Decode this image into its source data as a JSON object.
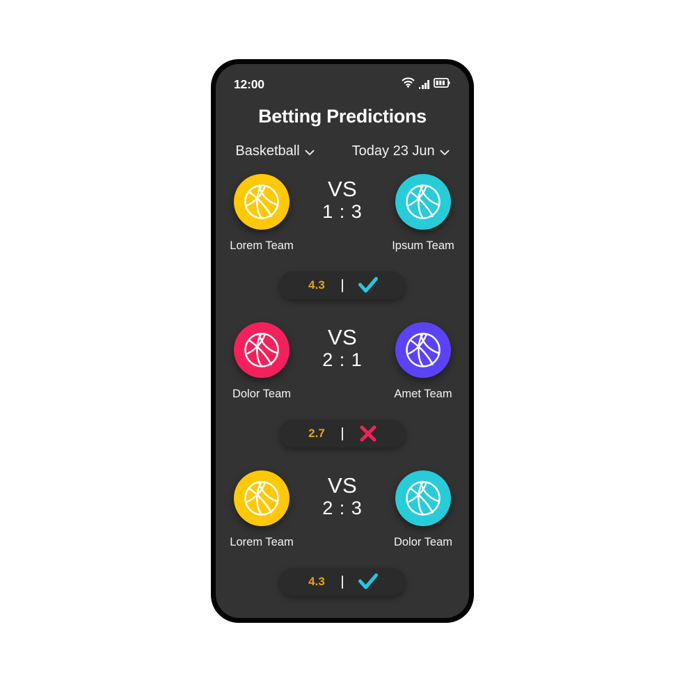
{
  "status_bar": {
    "time": "12:00",
    "icons": [
      "wifi-icon",
      "signal-icon",
      "battery-icon"
    ]
  },
  "header": {
    "title": "Betting Predictions"
  },
  "filters": [
    {
      "label": "Basketball",
      "icon": "chevron-down-icon"
    },
    {
      "label": "Today 23 Jun",
      "icon": "chevron-down-icon"
    }
  ],
  "colors": {
    "screen_bg": "#333333",
    "pill_bg": "#2b2b2b",
    "odds_text": "#e0a51c",
    "yellow": "#FFC808",
    "cyan": "#27CCD8",
    "pink": "#F4205C",
    "purple": "#5B43F5",
    "check": "#22C9E0",
    "cross": "#F4205C"
  },
  "matches": [
    {
      "home": {
        "name": "Lorem Team",
        "color": "#FFC808",
        "icon": "basketball-icon"
      },
      "away": {
        "name": "Ipsum Team",
        "color": "#27CCD8",
        "icon": "basketball-icon"
      },
      "vs_label": "VS",
      "score": "1 : 3",
      "odds": "4.3",
      "result": "win",
      "result_icon": "check-icon",
      "result_color": "#22C9E0"
    },
    {
      "home": {
        "name": "Dolor Team",
        "color": "#F4205C",
        "icon": "basketball-icon"
      },
      "away": {
        "name": "Amet Team",
        "color": "#5B43F5",
        "icon": "basketball-icon"
      },
      "vs_label": "VS",
      "score": "2 : 1",
      "odds": "2.7",
      "result": "lose",
      "result_icon": "cross-icon",
      "result_color": "#F4205C"
    },
    {
      "home": {
        "name": "Lorem Team",
        "color": "#FFC808",
        "icon": "basketball-icon"
      },
      "away": {
        "name": "Dolor Team",
        "color": "#27CCD8",
        "icon": "basketball-icon"
      },
      "vs_label": "VS",
      "score": "2 : 3",
      "odds": "4.3",
      "result": "win",
      "result_icon": "check-icon",
      "result_color": "#22C9E0"
    }
  ]
}
